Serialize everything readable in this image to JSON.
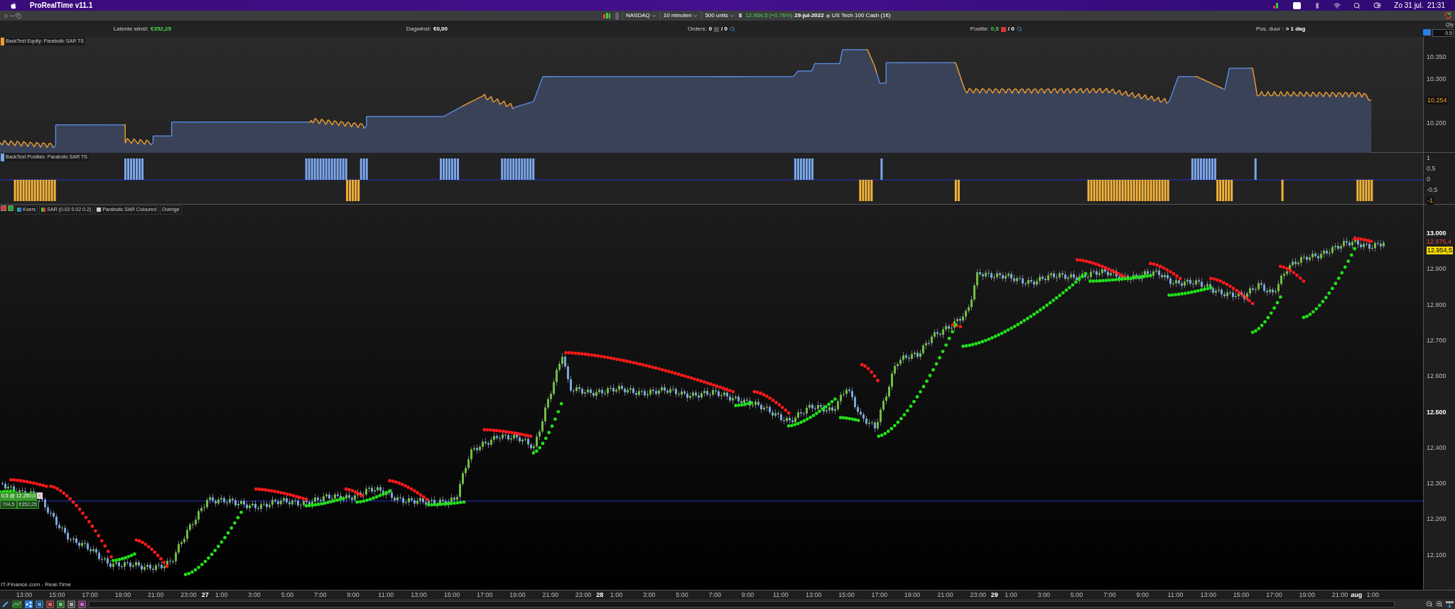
{
  "menu_bar": {
    "app_name": "ProRealTime v11.1",
    "clock": "Zo 31 jul.  21:31"
  },
  "toolbar": {
    "dropdowns": [
      {
        "label": "NASDAQ"
      },
      {
        "label": "10 minuten"
      },
      {
        "label": "500 units"
      }
    ],
    "currency": "$",
    "price": "12.954,5 (+0,76%)",
    "date": "29-jul-2022",
    "instrument": "US Tech 100 Cash (1€)"
  },
  "info_bar": [
    {
      "label": "Latente winst:",
      "value": "€352,25",
      "kind": "profit"
    },
    {
      "label": "Dagwinst:",
      "value": "€0,00",
      "kind": "plain"
    },
    {
      "label": "Orders:",
      "value": "0",
      "kind": "orders",
      "extra": "/ 0"
    },
    {
      "label": "Positie:",
      "value": "0,5",
      "kind": "position",
      "extra": "/ 0"
    },
    {
      "label": "Pos. duur :",
      "value": "> 1 dag",
      "kind": "plain"
    }
  ],
  "qty": {
    "label": "Qty",
    "value": "0.5"
  },
  "equity_panel": {
    "title": "BackTest Equity: Parabolic SAR TS",
    "y_ticks": [
      "10.350",
      "10.300",
      "10.200"
    ],
    "current_value": "10.254"
  },
  "positions_panel": {
    "title": "BackTest Posities: Parabolic SAR TS",
    "y_ticks": [
      "1",
      "0,5",
      "0",
      "-0,5"
    ],
    "current_value": "-1"
  },
  "price_panel": {
    "legend": [
      {
        "label": "Koers"
      },
      {
        "label": "SAR (0.02 0.02 0.2)"
      },
      {
        "label": "Parabolic SAR Coloured"
      },
      {
        "label": "Overige"
      }
    ],
    "y_ticks": [
      "13.000",
      "12.900",
      "12.800",
      "12.700",
      "12.600",
      "12.500",
      "12.400",
      "12.300",
      "12.200",
      "12.100"
    ],
    "markers": [
      {
        "value": "12.976,4",
        "kind": "sar"
      },
      {
        "value": "12.954,5",
        "kind": "last"
      }
    ],
    "position_box": {
      "size_price": "0,5 @ 12.250,0",
      "points": "704,5",
      "profit": "€352,25"
    },
    "source": "IT-Finance.com - Real-Time"
  },
  "time_axis": [
    {
      "label": "13:00",
      "kind": "hour"
    },
    {
      "label": "15:00",
      "kind": "hour"
    },
    {
      "label": "17:00",
      "kind": "hour"
    },
    {
      "label": "19:00",
      "kind": "hour"
    },
    {
      "label": "21:00",
      "kind": "hour"
    },
    {
      "label": "23:00",
      "kind": "hour"
    },
    {
      "label": "27",
      "kind": "day"
    },
    {
      "label": "1:00",
      "kind": "hour"
    },
    {
      "label": "3:00",
      "kind": "hour"
    },
    {
      "label": "5:00",
      "kind": "hour"
    },
    {
      "label": "7:00",
      "kind": "hour"
    },
    {
      "label": "9:00",
      "kind": "hour"
    },
    {
      "label": "11:00",
      "kind": "hour"
    },
    {
      "label": "13:00",
      "kind": "hour"
    },
    {
      "label": "15:00",
      "kind": "hour"
    },
    {
      "label": "17:00",
      "kind": "hour"
    },
    {
      "label": "19:00",
      "kind": "hour"
    },
    {
      "label": "21:00",
      "kind": "hour"
    },
    {
      "label": "23:00",
      "kind": "hour"
    },
    {
      "label": "28",
      "kind": "day"
    },
    {
      "label": "1:00",
      "kind": "hour"
    },
    {
      "label": "3:00",
      "kind": "hour"
    },
    {
      "label": "5:00",
      "kind": "hour"
    },
    {
      "label": "7:00",
      "kind": "hour"
    },
    {
      "label": "9:00",
      "kind": "hour"
    },
    {
      "label": "11:00",
      "kind": "hour"
    },
    {
      "label": "13:00",
      "kind": "hour"
    },
    {
      "label": "15:00",
      "kind": "hour"
    },
    {
      "label": "17:00",
      "kind": "hour"
    },
    {
      "label": "19:00",
      "kind": "hour"
    },
    {
      "label": "21:00",
      "kind": "hour"
    },
    {
      "label": "23:00",
      "kind": "hour"
    },
    {
      "label": "29",
      "kind": "day"
    },
    {
      "label": "1:00",
      "kind": "hour"
    },
    {
      "label": "3:00",
      "kind": "hour"
    },
    {
      "label": "5:00",
      "kind": "hour"
    },
    {
      "label": "7:00",
      "kind": "hour"
    },
    {
      "label": "9:00",
      "kind": "hour"
    },
    {
      "label": "11:00",
      "kind": "hour"
    },
    {
      "label": "13:00",
      "kind": "hour"
    },
    {
      "label": "15:00",
      "kind": "hour"
    },
    {
      "label": "17:00",
      "kind": "hour"
    },
    {
      "label": "19:00",
      "kind": "hour"
    },
    {
      "label": "21:00",
      "kind": "hour"
    },
    {
      "label": "aug",
      "kind": "day"
    },
    {
      "label": "1:00",
      "kind": "hour"
    }
  ]
}
